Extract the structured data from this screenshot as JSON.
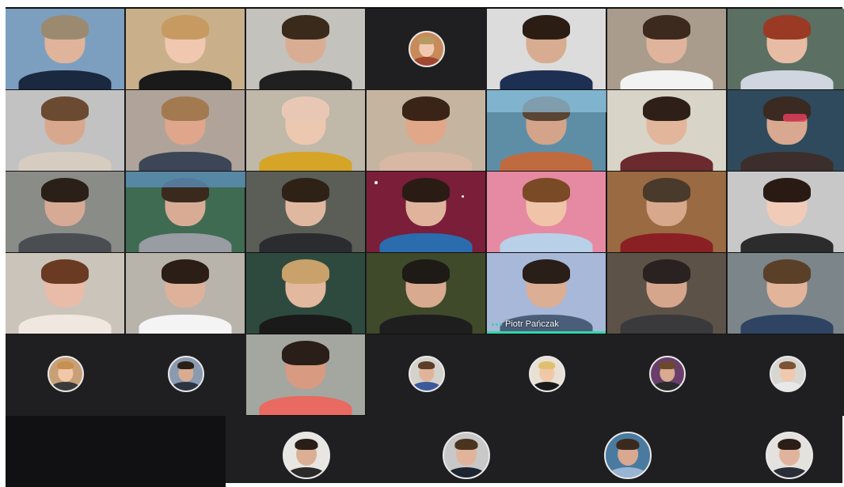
{
  "meeting": {
    "active_speaker": {
      "name": "Piotr Pańczak",
      "indicator_color": "#33d6a8"
    }
  },
  "colors": {
    "stage_background": "#1f1f22",
    "tile_border": "#111111",
    "name_text": "#ffffff"
  },
  "video_tiles": [
    {
      "id": "v-r1c1",
      "bg": "#7d9fbf",
      "skin": "#e0b49a",
      "hair": "#9b8a70",
      "shirt": "#1a2840"
    },
    {
      "id": "v-r1c2",
      "bg": "#c9b08a",
      "skin": "#f0c8b0",
      "hair": "#c79a62",
      "shirt": "#1a1a1a"
    },
    {
      "id": "v-r1c3",
      "bg": "#c4c2bd",
      "skin": "#d9ad93",
      "hair": "#3a2a1c",
      "shirt": "#202020"
    },
    {
      "id": "v-r1c5",
      "bg": "#dcdcdc",
      "skin": "#d8ac90",
      "hair": "#2b1d14",
      "shirt": "#1d2f52"
    },
    {
      "id": "v-r1c6",
      "bg": "#a99c8c",
      "skin": "#e0b49c",
      "hair": "#3c2a1e",
      "shirt": "#f2f2f2"
    },
    {
      "id": "v-r1c7",
      "bg": "#5b6f63",
      "skin": "#e8bca4",
      "hair": "#9a3a24",
      "shirt": "#cfd6e0"
    },
    {
      "id": "v-r2c1",
      "bg": "#c2c2c2",
      "skin": "#d8a88e",
      "hair": "#6b4a32",
      "shirt": "#d6ccc0"
    },
    {
      "id": "v-r2c2",
      "bg": "#b0a49a",
      "skin": "#dfa68c",
      "hair": "#a37950",
      "shirt": "#3c4656"
    },
    {
      "id": "v-r2c3",
      "bg": "#c0b8a8",
      "skin": "#edc8b0",
      "hair": "#e8c8b4",
      "shirt": "#d6a426"
    },
    {
      "id": "v-r2c4",
      "bg": "#c5b4a0",
      "skin": "#e0a888",
      "hair": "#3a2418",
      "shirt": "#d8b8a4"
    },
    {
      "id": "v-r2c5",
      "bg": "#5e8ea6",
      "skin": "#d4a48a",
      "hair": "#5a4434",
      "shirt": "#c06a40"
    },
    {
      "id": "v-r2c6",
      "bg": "#d9d4c8",
      "skin": "#e2b69a",
      "hair": "#2e2018",
      "shirt": "#6a2a2e"
    },
    {
      "id": "v-r2c7",
      "bg": "#2f4a5c",
      "skin": "#d8a890",
      "hair": "#3a2a22",
      "shirt": "#3c2e2a"
    },
    {
      "id": "v-r3c1",
      "bg": "#8a8c88",
      "skin": "#d6aa94",
      "hair": "#2a2018",
      "shirt": "#4a4e52"
    },
    {
      "id": "v-r3c2",
      "bg": "#3f6b52",
      "skin": "#d8ac94",
      "hair": "#3a2a1e",
      "shirt": "#9a9ca4"
    },
    {
      "id": "v-r3c3",
      "bg": "#5a5e56",
      "skin": "#e0b8a0",
      "hair": "#2e2216",
      "shirt": "#2a2c30"
    },
    {
      "id": "v-r3c4",
      "bg": "#7a1e3a",
      "skin": "#e0b49c",
      "hair": "#2a1c14",
      "shirt": "#2a6cae"
    },
    {
      "id": "v-r3c5",
      "bg": "#e58aa2",
      "skin": "#f0c4a8",
      "hair": "#7a4a26",
      "shirt": "#b8d0e8"
    },
    {
      "id": "v-r3c6",
      "bg": "#9a6a42",
      "skin": "#d8a88c",
      "hair": "#4a3a2c",
      "shirt": "#8a2024"
    },
    {
      "id": "v-r3c7",
      "bg": "#c8c8c8",
      "skin": "#f0ccb8",
      "hair": "#2a1a14",
      "shirt": "#2c2c2c"
    },
    {
      "id": "v-r4c1",
      "bg": "#cac4ba",
      "skin": "#e8bca8",
      "hair": "#6a3a22",
      "shirt": "#f0e8e0"
    },
    {
      "id": "v-r4c2",
      "bg": "#b8b4ac",
      "skin": "#deb29a",
      "hair": "#2a1e16",
      "shirt": "#f4f4f4"
    },
    {
      "id": "v-r4c3",
      "bg": "#2e4a3e",
      "skin": "#e2b89e",
      "hair": "#c8a26a",
      "shirt": "#1a1a1a"
    },
    {
      "id": "v-r4c4",
      "bg": "#3e4a2a",
      "skin": "#d8aa90",
      "hair": "#1e1a16",
      "shirt": "#1e1e1e"
    },
    {
      "id": "v-r4c5",
      "bg": "#a8b8d8",
      "skin": "#dcae94",
      "hair": "#2a1e18",
      "shirt": "#4a5e7a"
    },
    {
      "id": "v-r4c6",
      "bg": "#5c5248",
      "skin": "#d6a68c",
      "hair": "#2a2220",
      "shirt": "#3a3a3c"
    },
    {
      "id": "v-r4c7",
      "bg": "#7c858a",
      "skin": "#e2b49a",
      "hair": "#5a4028",
      "shirt": "#2e4462"
    },
    {
      "id": "v-r5c3",
      "bg": "#a4a6a0",
      "skin": "#d89a80",
      "hair": "#2a1e18",
      "shirt": "#e86a60"
    }
  ],
  "avatar_tiles": [
    {
      "id": "a-r5c1",
      "bg": "#c8a078",
      "skin": "#f0c8a8",
      "hair": "#c79050",
      "shirt": "#3a3a3a"
    },
    {
      "id": "a-r5c2",
      "bg": "#8a9ab0",
      "skin": "#d8ac92",
      "hair": "#2a2018",
      "shirt": "#2c3444"
    },
    {
      "id": "a-r5c4",
      "bg": "#d4d2cc",
      "skin": "#e0b49a",
      "hair": "#5a3e28",
      "shirt": "#3a5a9a"
    },
    {
      "id": "a-r5c5",
      "bg": "#e8e0d4",
      "skin": "#f0c8a8",
      "hair": "#e0c070",
      "shirt": "#1a1a1a"
    },
    {
      "id": "a-r5c6",
      "bg": "#6a3e6a",
      "skin": "#d8aa90",
      "hair": "#6a4a2a",
      "shirt": "#2a2a2a"
    },
    {
      "id": "a-r5c7",
      "bg": "#d8d6d2",
      "skin": "#f0c8ac",
      "hair": "#7a5434",
      "shirt": "#e8e8e8"
    },
    {
      "id": "a-r6c1",
      "bg": "#e8e6e2",
      "skin": "#dcae94",
      "hair": "#2a1e18",
      "shirt": "#2a2a2a"
    },
    {
      "id": "a-r6c2",
      "bg": "#c8c8c8",
      "skin": "#e0b49a",
      "hair": "#4a3420",
      "shirt": "#1e2430"
    },
    {
      "id": "a-r6c3",
      "bg": "#4a7aa0",
      "skin": "#d8a890",
      "hair": "#3a2a1e",
      "shirt": "#9ab4d4"
    },
    {
      "id": "a-r6c4",
      "bg": "#e4e2de",
      "skin": "#e0b49c",
      "hair": "#2a1e16",
      "shirt": "#2a2e36"
    },
    {
      "id": "a-r1c4",
      "bg": "#c88a5a",
      "skin": "#f0c8b0",
      "hair": "#b89a60",
      "shirt": "#a04830"
    }
  ]
}
